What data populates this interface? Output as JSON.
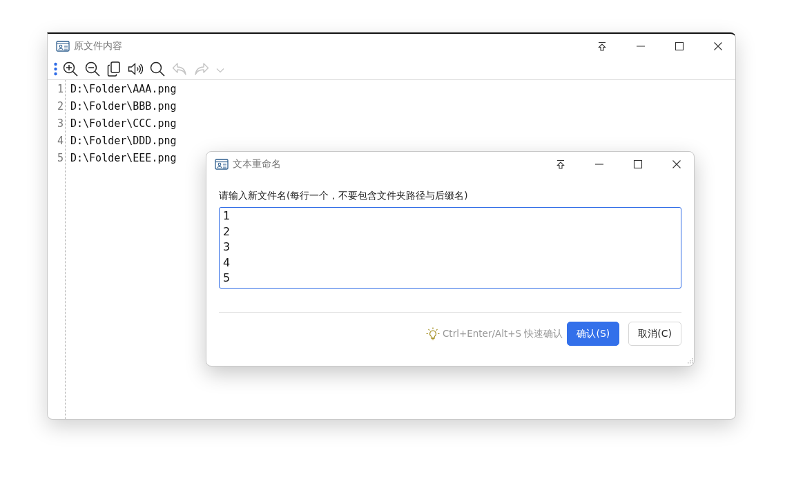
{
  "main_window": {
    "title": "原文件内容",
    "toolbar": [
      {
        "kind": "zoom-in",
        "disabled": false
      },
      {
        "kind": "zoom-out",
        "disabled": false
      },
      {
        "kind": "copy",
        "disabled": false
      },
      {
        "kind": "speaker",
        "disabled": false
      },
      {
        "kind": "search",
        "disabled": false
      },
      {
        "kind": "undo",
        "disabled": true
      },
      {
        "kind": "redo",
        "disabled": true
      },
      {
        "kind": "dropdown",
        "disabled": true
      }
    ],
    "lines": [
      {
        "number": "1",
        "text": "D:\\Folder\\AAA.png"
      },
      {
        "number": "2",
        "text": "D:\\Folder\\BBB.png"
      },
      {
        "number": "3",
        "text": "D:\\Folder\\CCC.png"
      },
      {
        "number": "4",
        "text": "D:\\Folder\\DDD.png"
      },
      {
        "number": "5",
        "text": "D:\\Folder\\EEE.png"
      }
    ]
  },
  "dialog": {
    "title": "文本重命名",
    "prompt": "请输入新文件名(每行一个，不要包含文件夹路径与后缀名)",
    "value": "1\n2\n3\n4\n5",
    "hint": "Ctrl+Enter/Alt+S 快速确认",
    "buttons": [
      {
        "label": "确认(S)",
        "kind": "primary"
      },
      {
        "label": "取消(C)",
        "kind": "secondary"
      }
    ]
  }
}
